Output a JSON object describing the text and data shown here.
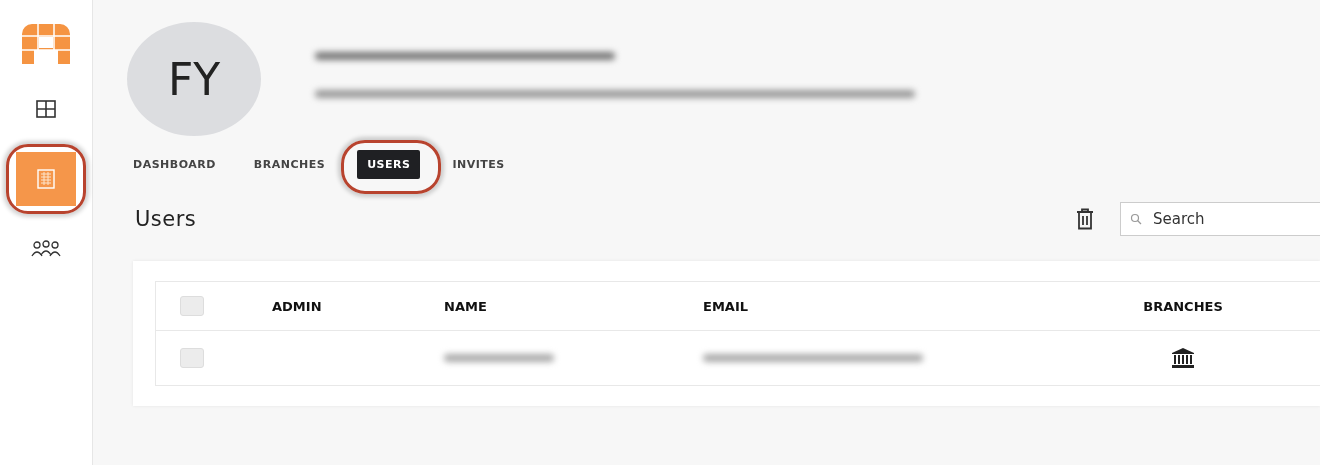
{
  "sidebar": {
    "items": [
      {
        "kind": "grid",
        "selected": false,
        "highlighted": false
      },
      {
        "kind": "building",
        "selected": true,
        "highlighted": true
      },
      {
        "kind": "people",
        "selected": false,
        "highlighted": false
      }
    ]
  },
  "profile": {
    "initials": "FY"
  },
  "tabs": [
    {
      "label": "DASHBOARD",
      "selected": false,
      "highlighted": false
    },
    {
      "label": "BRANCHES",
      "selected": false,
      "highlighted": false
    },
    {
      "label": "USERS",
      "selected": true,
      "highlighted": true
    },
    {
      "label": "INVITES",
      "selected": false,
      "highlighted": false
    }
  ],
  "heading": "Users",
  "search": {
    "placeholder": "Search"
  },
  "table": {
    "select_all": {
      "checked": false
    },
    "columns": [
      "ADMIN",
      "NAME",
      "EMAIL",
      "BRANCHES"
    ],
    "rows": [
      {
        "checked": false
      }
    ]
  }
}
